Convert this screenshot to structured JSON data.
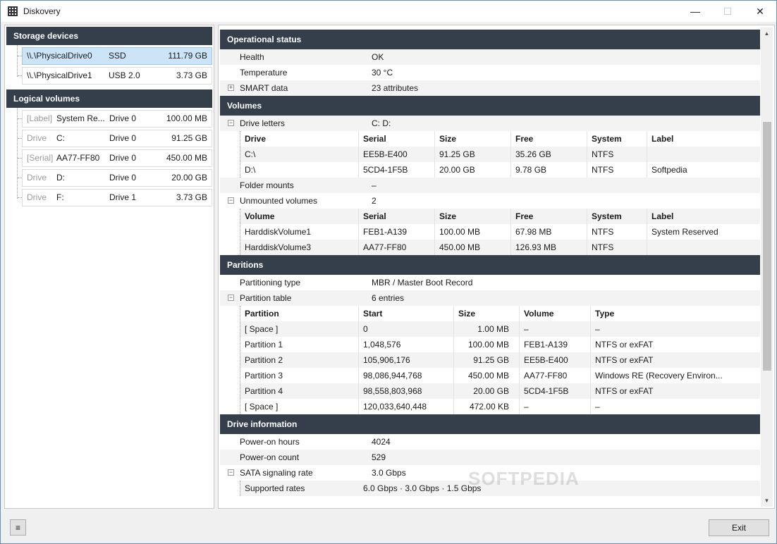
{
  "window": {
    "title": "Diskovery",
    "minimize": "—",
    "maximize": "☐",
    "close": "✕"
  },
  "storage": {
    "header": "Storage devices",
    "devices": [
      {
        "name": "\\\\.\\PhysicalDrive0",
        "type": "SSD",
        "size": "111.79 GB"
      },
      {
        "name": "\\\\.\\PhysicalDrive1",
        "type": "USB 2.0",
        "size": "3.73 GB"
      }
    ]
  },
  "logical": {
    "header": "Logical volumes",
    "volumes": [
      {
        "kind": "[Label]",
        "name": "System Re...",
        "drive": "Drive 0",
        "size": "100.00 MB"
      },
      {
        "kind": "Drive",
        "name": "C:",
        "drive": "Drive 0",
        "size": "91.25 GB"
      },
      {
        "kind": "[Serial]",
        "name": "AA77-FF80",
        "drive": "Drive 0",
        "size": "450.00 MB"
      },
      {
        "kind": "Drive",
        "name": "D:",
        "drive": "Drive 0",
        "size": "20.00 GB"
      },
      {
        "kind": "Drive",
        "name": "F:",
        "drive": "Drive 1",
        "size": "3.73 GB"
      }
    ]
  },
  "operational": {
    "header": "Operational status",
    "health_key": "Health",
    "health_val": "OK",
    "temp_key": "Temperature",
    "temp_val": "30 °C",
    "smart_key": "SMART data",
    "smart_val": "23 attributes"
  },
  "volumes": {
    "header": "Volumes",
    "letters_key": "Drive letters",
    "letters_val": "C:  D:",
    "letters_cols": [
      "Drive",
      "Serial",
      "Size",
      "Free",
      "System",
      "Label"
    ],
    "letters_rows": [
      [
        "C:\\",
        "EE5B-E400",
        "91.25 GB",
        "35.26 GB",
        "NTFS",
        ""
      ],
      [
        "D:\\",
        "5CD4-1F5B",
        "20.00 GB",
        "9.78 GB",
        "NTFS",
        "Softpedia"
      ]
    ],
    "mounts_key": "Folder mounts",
    "mounts_val": "–",
    "unmounted_key": "Unmounted volumes",
    "unmounted_val": "2",
    "unmounted_cols": [
      "Volume",
      "Serial",
      "Size",
      "Free",
      "System",
      "Label"
    ],
    "unmounted_rows": [
      [
        "HarddiskVolume1",
        "FEB1-A139",
        "100.00 MB",
        "67.98 MB",
        "NTFS",
        "System Reserved"
      ],
      [
        "HarddiskVolume3",
        "AA77-FF80",
        "450.00 MB",
        "126.93 MB",
        "NTFS",
        ""
      ]
    ]
  },
  "partitions": {
    "header": "Paritions",
    "type_key": "Partitioning type",
    "type_val": "MBR / Master Boot Record",
    "table_key": "Partition table",
    "table_val": "6 entries",
    "cols": [
      "Partition",
      "Start",
      "Size",
      "Volume",
      "Type"
    ],
    "rows": [
      [
        "[ Space ]",
        "0",
        "1.00 MB",
        "–",
        "–"
      ],
      [
        "Partition 1",
        "1,048,576",
        "100.00 MB",
        "FEB1-A139",
        "NTFS or exFAT"
      ],
      [
        "Partition 2",
        "105,906,176",
        "91.25 GB",
        "EE5B-E400",
        "NTFS or exFAT"
      ],
      [
        "Partition 3",
        "98,086,944,768",
        "450.00 MB",
        "AA77-FF80",
        "Windows RE (Recovery Environ..."
      ],
      [
        "Partition 4",
        "98,558,803,968",
        "20.00 GB",
        "5CD4-1F5B",
        "NTFS or exFAT"
      ],
      [
        "[ Space ]",
        "120,033,640,448",
        "472.00 KB",
        "–",
        "–"
      ]
    ]
  },
  "driveinfo": {
    "header": "Drive information",
    "hours_key": "Power-on hours",
    "hours_val": "4024",
    "count_key": "Power-on count",
    "count_val": "529",
    "sata_key": "SATA signaling rate",
    "sata_val": "3.0 Gbps",
    "rates_key": "Supported rates",
    "rates_val": "6.0 Gbps  ·  3.0 Gbps  ·  1.5 Gbps"
  },
  "watermark": "SOFTPEDIA",
  "footer": {
    "menu_icon": "≡",
    "exit_label": "Exit"
  }
}
